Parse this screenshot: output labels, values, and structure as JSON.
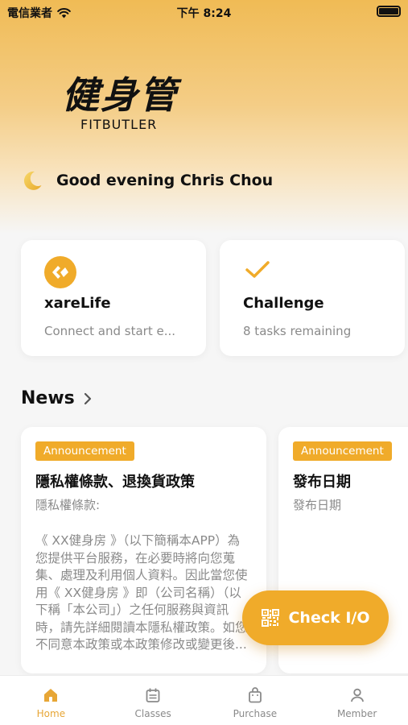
{
  "status_bar": {
    "carrier": "電信業者",
    "time": "下午 8:24"
  },
  "logo": {
    "main": "健身管",
    "sub": "FITBUTLER"
  },
  "greeting": "Good evening Chris Chou",
  "cards": [
    {
      "title": "xareLife",
      "subtitle": "Connect and start e..."
    },
    {
      "title": "Challenge",
      "subtitle": "8 tasks remaining"
    }
  ],
  "news": {
    "heading": "News",
    "items": [
      {
        "badge": "Announcement",
        "title": "隱私權條款、退換貨政策",
        "subtitle": "隱私權條款:",
        "body": "《 XX健身房 》（以下簡稱本APP）為您提供平台服務，在必要時將向您蒐集、處理及利用個人資料。因此當您使用《 XX健身房 》即（公司名稱）（以下稱「本公司」）之任何服務與資訊時，請先詳細閱讀本隱私權政策。如您不同意本政策或本政策修改或變更後..."
      },
      {
        "badge": "Announcement",
        "title": "發布日期",
        "subtitle": "發布日期"
      }
    ]
  },
  "check_button": {
    "label": "Check I/O"
  },
  "tabs": [
    {
      "label": "Home",
      "icon": "home-icon",
      "active": true
    },
    {
      "label": "Classes",
      "icon": "calendar-icon",
      "active": false
    },
    {
      "label": "Purchase",
      "icon": "bag-icon",
      "active": false
    },
    {
      "label": "Member",
      "icon": "person-icon",
      "active": false
    }
  ],
  "colors": {
    "accent": "#f0ab2a",
    "tab_active": "#e7a636",
    "muted": "#8a8a8a"
  }
}
